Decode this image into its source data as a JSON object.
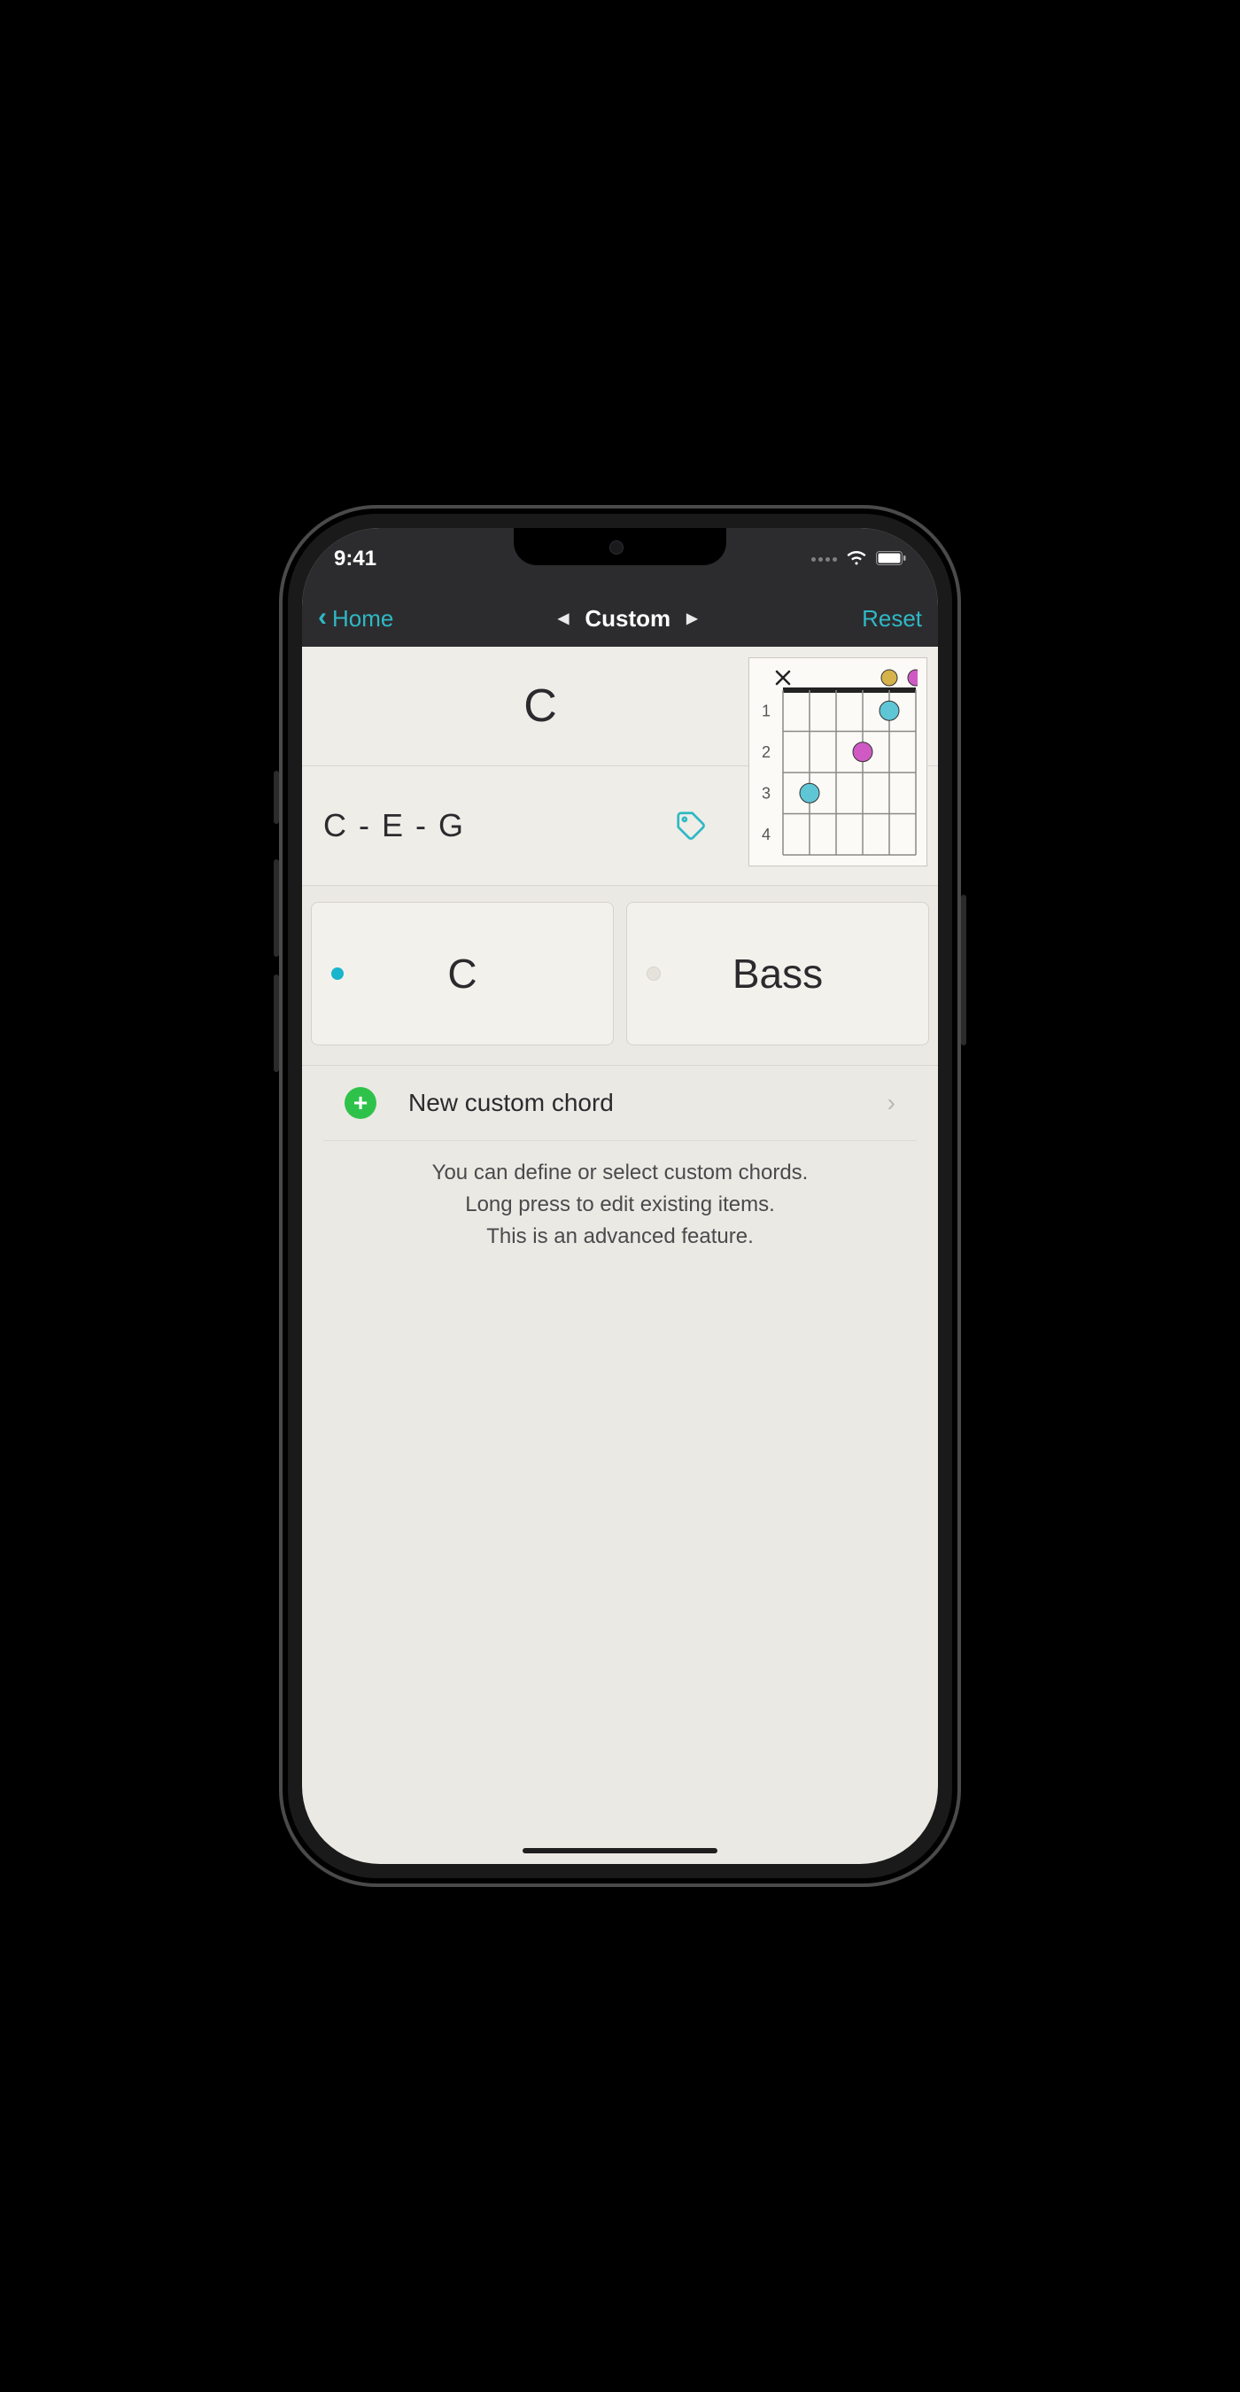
{
  "status": {
    "time": "9:41"
  },
  "nav": {
    "back": "Home",
    "title": "Custom",
    "reset": "Reset"
  },
  "chord": {
    "name": "C",
    "notes": "C - E - G",
    "diagram": {
      "fret_labels": [
        "1",
        "2",
        "3",
        "4"
      ],
      "mute_string_index": 0,
      "open_dots": [
        {
          "string": 4,
          "color": "#d6b24a"
        },
        {
          "string": 5,
          "color": "#d05ac4"
        }
      ],
      "finger_dots": [
        {
          "fret": 1,
          "string": 4,
          "color": "#5fc6d6"
        },
        {
          "fret": 2,
          "string": 3,
          "color": "#d05ac4"
        },
        {
          "fret": 3,
          "string": 1,
          "color": "#5fc6d6"
        }
      ]
    }
  },
  "selectors": {
    "root": {
      "label": "C",
      "active": true
    },
    "bass": {
      "label": "Bass",
      "active": false
    }
  },
  "new_chord": {
    "label": "New custom chord"
  },
  "hint": {
    "line1": "You can define or select custom chords.",
    "line2": "Long press to edit existing items.",
    "line3": "This is an advanced feature."
  },
  "colors": {
    "accent": "#2fb8c5",
    "green": "#2fc24a"
  }
}
